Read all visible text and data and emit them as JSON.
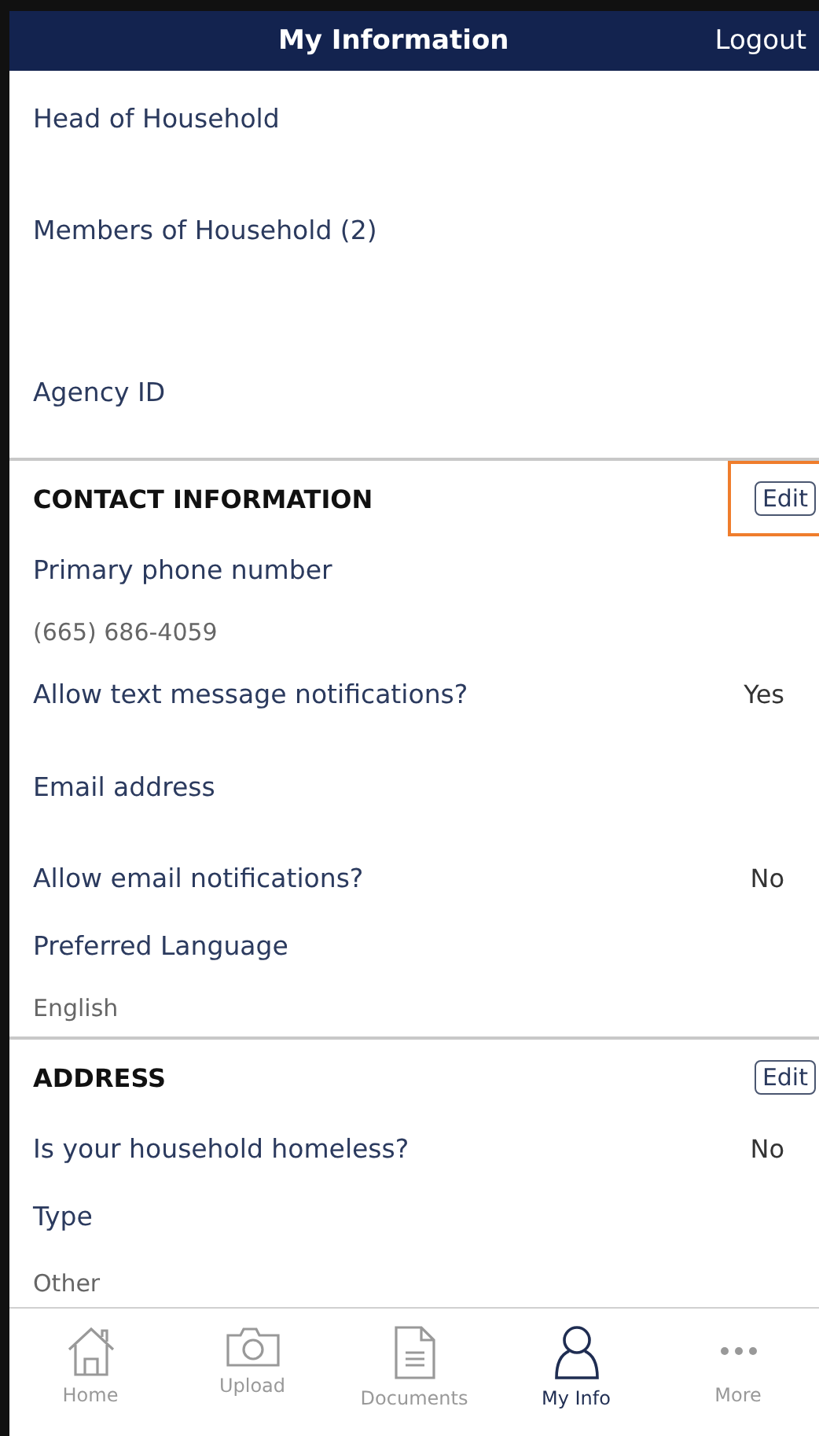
{
  "header": {
    "title": "My Information",
    "logout": "Logout"
  },
  "household": [
    {
      "label": "Head of Household"
    },
    {
      "label": "Members of Household (2)"
    },
    {
      "label": "Agency ID"
    }
  ],
  "sections": [
    {
      "heading": "CONTACT INFORMATION",
      "edit": "Edit",
      "highlighted": true,
      "lines": [
        {
          "kind": "label",
          "text": "Primary phone number"
        },
        {
          "kind": "value",
          "text": "(665) 686-4059"
        },
        {
          "kind": "question",
          "text": "Allow text message notifications?",
          "answer": "Yes"
        },
        {
          "kind": "label",
          "text": "Email address"
        },
        {
          "kind": "question",
          "text": "Allow email notifications?",
          "answer": "No"
        },
        {
          "kind": "label",
          "text": "Preferred Language"
        },
        {
          "kind": "value",
          "text": "English"
        }
      ]
    },
    {
      "heading": "ADDRESS",
      "edit": "Edit",
      "highlighted": false,
      "lines": [
        {
          "kind": "question",
          "text": "Is your household homeless?",
          "answer": "No"
        },
        {
          "kind": "label",
          "text": "Type"
        },
        {
          "kind": "value",
          "text": "Other"
        }
      ]
    }
  ],
  "tabs": [
    {
      "label": "Home",
      "selected": false
    },
    {
      "label": "Upload",
      "selected": false
    },
    {
      "label": "Documents",
      "selected": false
    },
    {
      "label": "My Info",
      "selected": true
    },
    {
      "label": "More",
      "selected": false
    }
  ]
}
